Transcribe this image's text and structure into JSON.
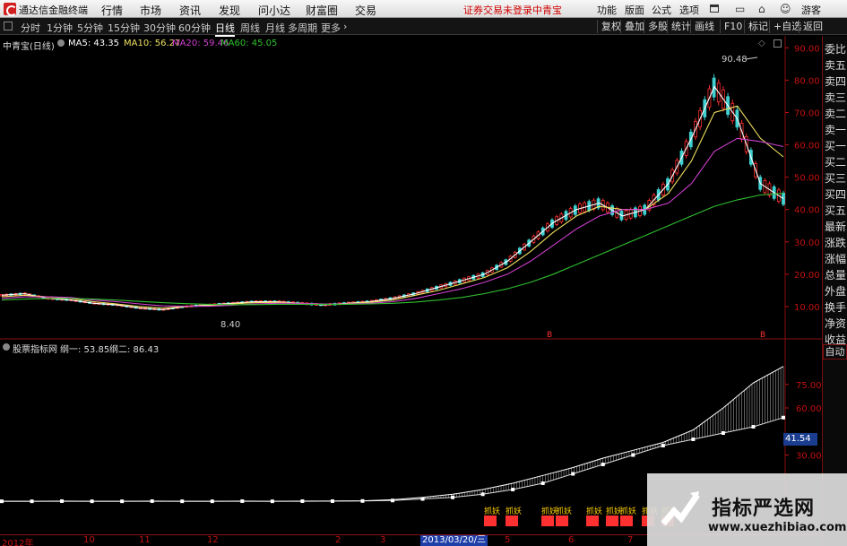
{
  "titlebar": {
    "app_name": "通达信金融终端",
    "menus": [
      "行情",
      "市场",
      "资讯",
      "发现",
      "问小达",
      "财富圈",
      "交易"
    ],
    "notice": "证券交易未登录",
    "stock_name": "中青宝",
    "right_menus": [
      "功能",
      "版面",
      "公式",
      "选项",
      "游客"
    ]
  },
  "toolbar": {
    "periods": [
      "分时",
      "1分钟",
      "5分钟",
      "15分钟",
      "30分钟",
      "60分钟",
      "日线",
      "周线",
      "月线",
      "多周期",
      "更多"
    ],
    "active_period": "日线",
    "right_buttons": [
      "复权",
      "叠加",
      "多股",
      "统计",
      "画线",
      "F10",
      "标记",
      "+自选",
      "返回"
    ]
  },
  "main_legend": {
    "title": "中青宝(日线)",
    "ma5": "MA5: 43.35",
    "ma10": "MA10: 56.27",
    "ma20": "MA20: 59.46",
    "ma60": "MA60: 45.05"
  },
  "sub_legend": {
    "title": "股票指标网",
    "line1": "纲一: 53.85",
    "line2": "纲二: 86.43"
  },
  "annotations": {
    "high": "90.48",
    "low": "8.40",
    "markers": [
      "B",
      "B",
      "B"
    ],
    "sell_signal": "抓妖"
  },
  "price_axis": [
    "90.00",
    "80.00",
    "70.00",
    "60.00",
    "50.00",
    "40.00",
    "30.00",
    "20.00",
    "10.00"
  ],
  "sub_axis": [
    "75.00",
    "60.00",
    "30.00"
  ],
  "sub_current_value": "41.54",
  "date_axis": [
    "2012年",
    "10",
    "11",
    "12",
    "2",
    "3",
    "5",
    "6",
    "7"
  ],
  "selected_date": "2013/03/20/三",
  "right_panel": [
    "委比",
    "卖五",
    "卖四",
    "卖三",
    "卖二",
    "卖一",
    "买一",
    "买二",
    "买三",
    "买四",
    "买五",
    "最新",
    "涨跌",
    "涨幅",
    "总量",
    "外盘",
    "换手",
    "净资",
    "收益"
  ],
  "auto_button": "自动",
  "watermark": {
    "title": "指标严选网",
    "url": "www.xuezhibiao.com"
  },
  "colors": {
    "up": "#ff3030",
    "down": "#40d0d0",
    "ma5": "#ffffff",
    "ma10": "#f0e060",
    "ma20": "#d040d0",
    "ma60": "#30c030",
    "axis": "#c41010"
  },
  "chart_data": {
    "type": "line",
    "title": "中青宝(日线)",
    "price_ylim": [
      0,
      95
    ],
    "series": [
      {
        "name": "MA5",
        "values": [
          13.5,
          14,
          12.5,
          12,
          11,
          10.5,
          9.5,
          9,
          10,
          10.5,
          11,
          11.5,
          11.5,
          11,
          10.5,
          11,
          11.5,
          12.5,
          14,
          16,
          18,
          20,
          24,
          30,
          36,
          40,
          42,
          38,
          40,
          48,
          62,
          78,
          68,
          48,
          43.35
        ]
      },
      {
        "name": "MA10",
        "values": [
          13,
          13.5,
          13,
          12.5,
          11.5,
          10.8,
          10,
          9.5,
          10,
          10.3,
          10.8,
          11.2,
          11.3,
          11,
          10.7,
          10.9,
          11.3,
          12,
          13.5,
          15,
          17,
          19,
          22,
          27,
          33,
          38,
          41,
          40,
          40,
          45,
          55,
          70,
          72,
          62,
          56.27
        ]
      },
      {
        "name": "MA20",
        "values": [
          12.5,
          13,
          13,
          12.8,
          12,
          11.5,
          10.8,
          10.2,
          10.1,
          10.1,
          10.4,
          10.8,
          11,
          11,
          10.8,
          10.8,
          11,
          11.5,
          12.5,
          14,
          15.5,
          17.5,
          20,
          24,
          29,
          34,
          38,
          40,
          40,
          42,
          48,
          58,
          62,
          61,
          59.46
        ]
      },
      {
        "name": "MA60",
        "values": [
          12,
          12.3,
          12.5,
          12.5,
          12.3,
          12,
          11.6,
          11.2,
          10.9,
          10.7,
          10.6,
          10.6,
          10.7,
          10.7,
          10.7,
          10.7,
          10.8,
          11,
          11.4,
          12,
          12.8,
          14,
          15.5,
          17.5,
          20,
          23,
          26,
          29,
          32,
          35,
          38,
          41,
          43,
          44.5,
          45.05
        ]
      }
    ],
    "sub_series": [
      {
        "name": "纲一",
        "values": [
          0.5,
          0.5,
          0.6,
          0.5,
          0.5,
          0.6,
          0.5,
          0.5,
          0.6,
          0.5,
          0.6,
          0.6,
          0.7,
          1,
          2,
          3,
          5,
          8,
          12,
          18,
          24,
          30,
          36,
          40,
          44,
          48,
          53.85
        ]
      },
      {
        "name": "纲二",
        "values": [
          0.5,
          0.5,
          0.5,
          0.5,
          0.5,
          0.5,
          0.5,
          0.5,
          0.5,
          0.5,
          0.5,
          0.6,
          0.8,
          1.5,
          3,
          5,
          8,
          12,
          17,
          22,
          28,
          33,
          38,
          46,
          60,
          76,
          86.43
        ]
      }
    ]
  }
}
